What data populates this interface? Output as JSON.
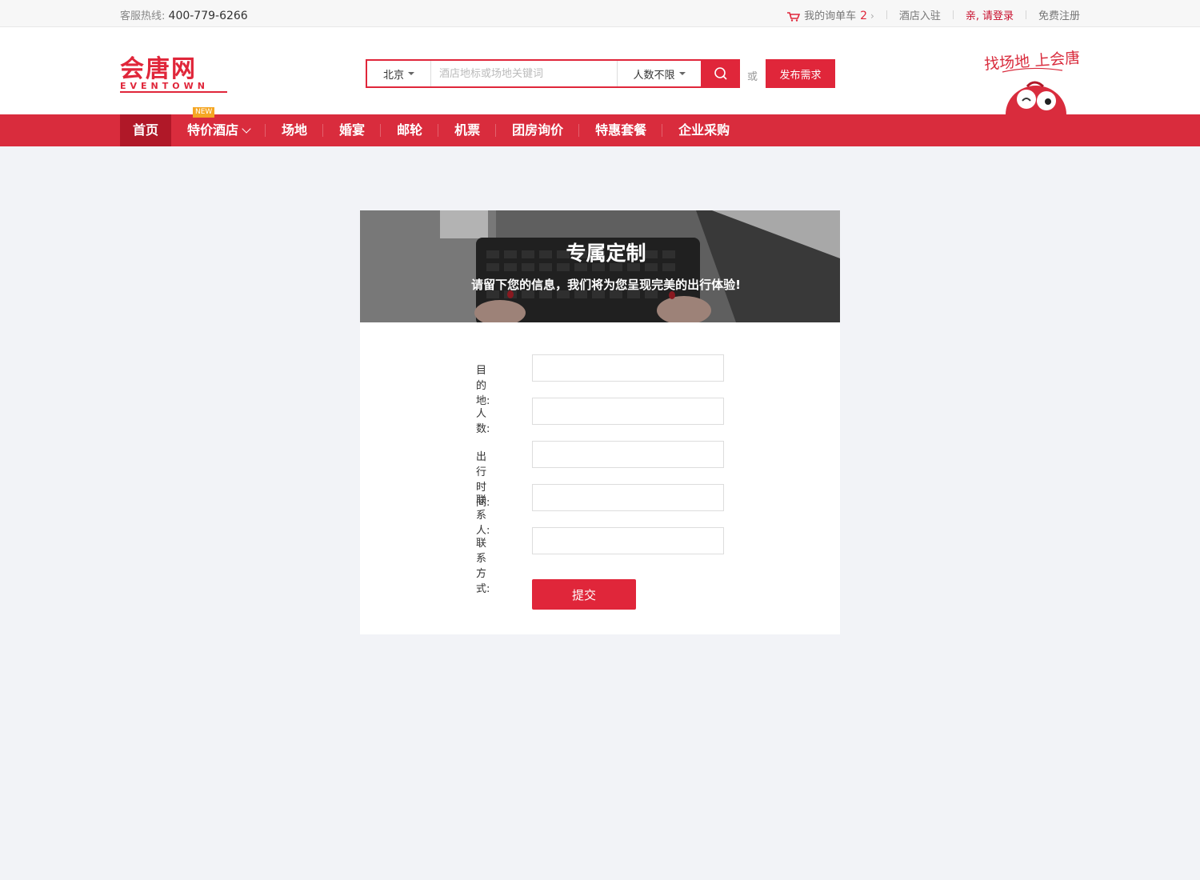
{
  "topbar": {
    "hotline_label": "客服热线:",
    "hotline_number": "400-779-6266",
    "cart_label": "我的询单车",
    "cart_count": "2",
    "hotel_join": "酒店入驻",
    "login_greet": "亲,",
    "login_link": "请登录",
    "register": "免费注册"
  },
  "header": {
    "logo_cn": "会唐网",
    "logo_en": "EVENTOWN",
    "search": {
      "city": "北京",
      "placeholder": "酒店地标或场地关键词",
      "people": "人数不限"
    },
    "or_text": "或",
    "publish_label": "发布需求",
    "slogan": "找场地 上会唐"
  },
  "nav": {
    "items": [
      {
        "label": "首页"
      },
      {
        "label": "特价酒店",
        "badge": "NEW"
      },
      {
        "label": "场地"
      },
      {
        "label": "婚宴"
      },
      {
        "label": "邮轮"
      },
      {
        "label": "机票"
      },
      {
        "label": "团房询价"
      },
      {
        "label": "特惠套餐"
      },
      {
        "label": "企业采购"
      }
    ]
  },
  "banner": {
    "title": "专属定制",
    "subtitle": "请留下您的信息，我们将为您呈现完美的出行体验!"
  },
  "form": {
    "fields": [
      {
        "label": "目的地:",
        "value": ""
      },
      {
        "label": "人数:",
        "value": ""
      },
      {
        "label": "出行时间:",
        "value": ""
      },
      {
        "label": "联系人:",
        "value": ""
      },
      {
        "label": "联系方式:",
        "value": ""
      }
    ],
    "submit_label": "提交"
  },
  "colors": {
    "brand_red": "#e0263a",
    "nav_red": "#d92c3d",
    "nav_active": "#b01828",
    "badge_orange": "#f5a623"
  }
}
